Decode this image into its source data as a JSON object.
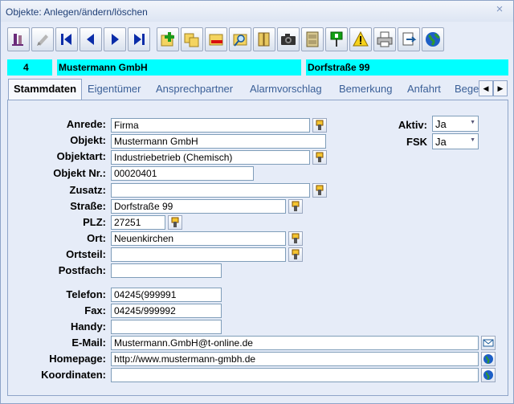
{
  "window": {
    "title": "Objekte: Anlegen/ändern/löschen"
  },
  "toolbar": {
    "buttons": [
      "user-icon",
      "edit-icon",
      "first-record-icon",
      "previous-record-icon",
      "next-record-icon",
      "last-record-icon",
      "new-record-icon",
      "copy-record-icon",
      "delete-record-icon",
      "search-icon",
      "notes-icon",
      "camera-icon",
      "archive-icon",
      "location-marker-icon",
      "warning-icon",
      "print-icon",
      "export-icon",
      "globe-icon"
    ]
  },
  "header": {
    "id": "4",
    "name": "Mustermann GmbH",
    "street": "Dorfstraße 99",
    "color": "#00ffff"
  },
  "tabs": [
    "Stammdaten",
    "Eigentümer",
    "Ansprechpartner",
    "Alarmvorschlag",
    "Bemerkung",
    "Anfahrt",
    "Bege"
  ],
  "form": {
    "anrede": {
      "label": "Anrede:",
      "value": "Firma"
    },
    "objekt": {
      "label": "Objekt:",
      "value": "Mustermann GmbH"
    },
    "objektart": {
      "label": "Objektart:",
      "value": "Industriebetrieb (Chemisch)"
    },
    "objekt_nr": {
      "label": "Objekt Nr.:",
      "value": "00020401"
    },
    "zusatz": {
      "label": "Zusatz:",
      "value": ""
    },
    "strasse": {
      "label": "Straße:",
      "value": "Dorfstraße 99"
    },
    "plz": {
      "label": "PLZ:",
      "value": "27251"
    },
    "ort": {
      "label": "Ort:",
      "value": "Neuenkirchen"
    },
    "ortsteil": {
      "label": "Ortsteil:",
      "value": ""
    },
    "postfach": {
      "label": "Postfach:",
      "value": ""
    },
    "telefon": {
      "label": "Telefon:",
      "value": "04245(999991"
    },
    "fax": {
      "label": "Fax:",
      "value": "04245/999992"
    },
    "handy": {
      "label": "Handy:",
      "value": ""
    },
    "email": {
      "label": "E-Mail:",
      "value": "Mustermann.GmbH@t-online.de"
    },
    "homepage": {
      "label": "Homepage:",
      "value": "http://www.mustermann-gmbh.de"
    },
    "koordinaten": {
      "label": "Koordinaten:",
      "value": ""
    },
    "aktiv": {
      "label": "Aktiv:",
      "value": "Ja"
    },
    "fsk": {
      "label": "FSK",
      "value": "Ja"
    }
  }
}
